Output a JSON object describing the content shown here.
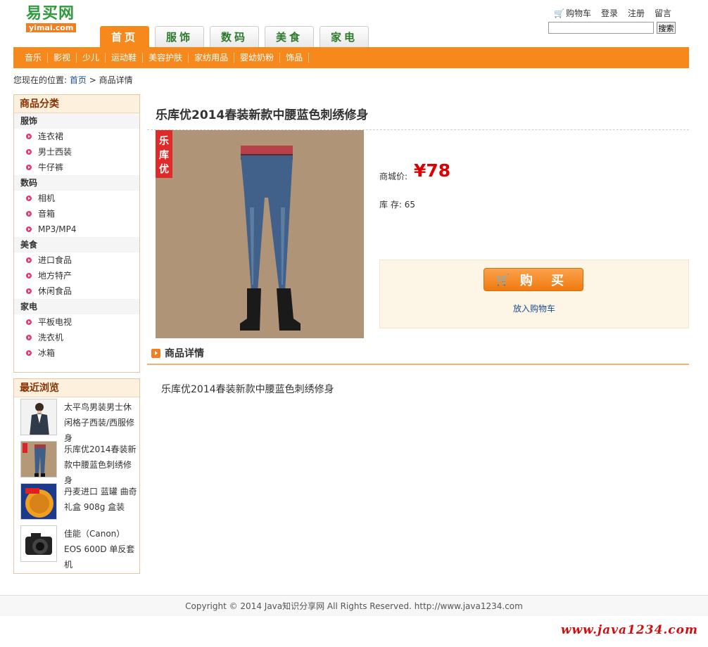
{
  "logo": {
    "cn": "易买网",
    "en": "yimai.com"
  },
  "toplinks": {
    "cart": "购物车",
    "login": "登录",
    "register": "注册",
    "message": "留言"
  },
  "search": {
    "button": "搜索",
    "value": ""
  },
  "tabs": [
    "首页",
    "服饰",
    "数码",
    "美食",
    "家电"
  ],
  "subnav": [
    "音乐",
    "影视",
    "少儿",
    "运动鞋",
    "美容护肤",
    "家纺用品",
    "婴幼奶粉",
    "饰品"
  ],
  "breadcrumb": {
    "prefix": "您现在的位置:",
    "home": "首页",
    "sep": ">",
    "current": "商品详情"
  },
  "sidebar": {
    "categories_title": "商品分类",
    "categories": [
      {
        "name": "服饰",
        "items": [
          "连衣裙",
          "男士西装",
          "牛仔裤"
        ]
      },
      {
        "name": "数码",
        "items": [
          "相机",
          "音箱",
          "MP3/MP4"
        ]
      },
      {
        "name": "美食",
        "items": [
          "进口食品",
          "地方特产",
          "休闲食品"
        ]
      },
      {
        "name": "家电",
        "items": [
          "平板电视",
          "洗衣机",
          "冰箱"
        ]
      }
    ],
    "recent_title": "最近浏览",
    "recent": [
      {
        "text": "太平鸟男装男士休闲格子西装/西服修身"
      },
      {
        "text": "乐库优2014春装新款中腰蓝色刺绣修身"
      },
      {
        "text": "丹麦进口 蓝罐 曲奇 礼盒 908g 盒装"
      },
      {
        "text": "佳能（Canon）EOS 600D 单反套机"
      }
    ]
  },
  "product": {
    "title": "乐库优2014春装新款中腰蓝色刺绣修身",
    "image_badge": "乐库优",
    "price_label": "商城价:",
    "price": "¥78",
    "stock_label": "库 存:",
    "stock": "65",
    "buy_label": "购 买",
    "addcart_label": "放入购物车",
    "detail_title": "商品详情",
    "detail_text": "乐库优2014春装新款中腰蓝色刺绣修身"
  },
  "footer": {
    "text": "Copyright © 2014 Java知识分享网 All Rights Reserved. http://www.java1234.com"
  },
  "watermark": "www.java1234.com",
  "colors": {
    "accent": "#f7891c",
    "price": "#dd0000",
    "logo_green": "#2d9a3c"
  }
}
